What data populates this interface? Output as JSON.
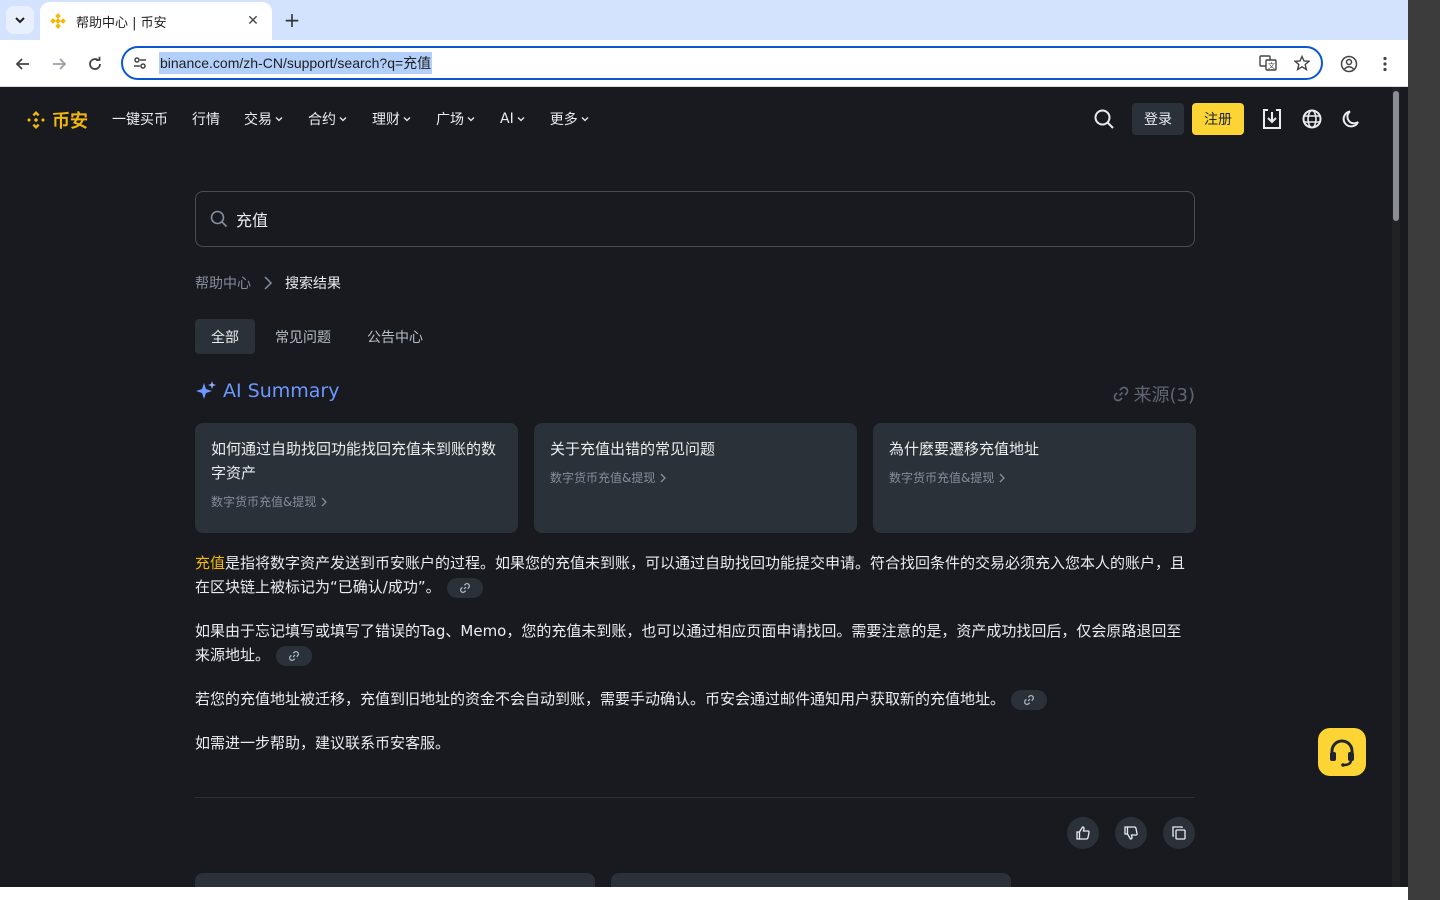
{
  "browser": {
    "tab_title": "帮助中心 | 币安",
    "url": "binance.com/zh-CN/support/search?q=充值"
  },
  "header": {
    "logo_text": "币安",
    "nav": [
      {
        "label": "一键买币",
        "dropdown": false
      },
      {
        "label": "行情",
        "dropdown": false
      },
      {
        "label": "交易",
        "dropdown": true
      },
      {
        "label": "合约",
        "dropdown": true
      },
      {
        "label": "理财",
        "dropdown": true
      },
      {
        "label": "广场",
        "dropdown": true
      },
      {
        "label": "AI",
        "dropdown": true
      },
      {
        "label": "更多",
        "dropdown": true
      }
    ],
    "login_label": "登录",
    "register_label": "注册"
  },
  "search": {
    "value": "充值"
  },
  "breadcrumb": {
    "home": "帮助中心",
    "current": "搜索结果"
  },
  "filter_tabs": [
    {
      "label": "全部",
      "active": true
    },
    {
      "label": "常见问题",
      "active": false
    },
    {
      "label": "公告中心",
      "active": false
    }
  ],
  "ai_summary": {
    "title": "AI Summary",
    "sources_label": "来源(3)",
    "cards": [
      {
        "title": "如何通过自助找回功能找回充值未到账的数字资产",
        "category": "数字货币充值&提现"
      },
      {
        "title": "关于充值出错的常见问题",
        "category": "数字货币充值&提现"
      },
      {
        "title": "為什麼要遷移充值地址",
        "category": "数字货币充值&提现"
      }
    ],
    "paragraphs": {
      "p1_highlight": "充值",
      "p1_rest": "是指将数字资产发送到币安账户的过程。如果您的充值未到账，可以通过自助找回功能提交申请。符合找回条件的交易必须充入您本人的账户，且在区块链上被标记为“已确认/成功”。",
      "p2": "如果由于忘记填写或填写了错误的Tag、Memo，您的充值未到账，也可以通过相应页面申请找回。需要注意的是，资产成功找回后，仅会原路退回至来源地址。",
      "p3": "若您的充值地址被迁移，充值到旧地址的资金不会自动到账，需要手动确认。币安会通过邮件通知用户获取新的充值地址。",
      "p4": "如需进一步帮助，建议联系币安客服。"
    }
  },
  "colors": {
    "accent": "#f0b90b",
    "button_yellow": "#fcd535",
    "ai_blue": "#6c98ff",
    "page_bg": "#181a20",
    "card_bg": "#2b3139"
  }
}
